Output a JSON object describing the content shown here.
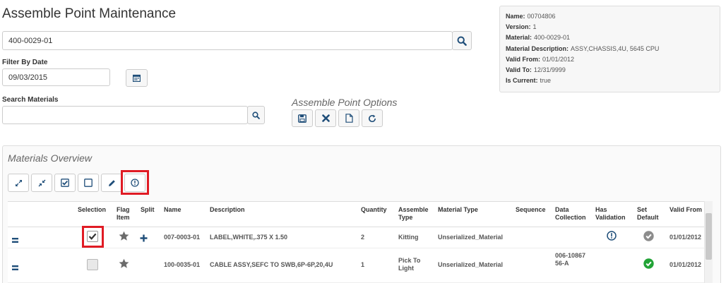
{
  "page": {
    "title": "Assemble Point Maintenance"
  },
  "search": {
    "value": "400-0029-01"
  },
  "filter": {
    "label": "Filter By Date",
    "value": "09/03/2015"
  },
  "materials_search": {
    "label": "Search Materials",
    "value": ""
  },
  "info": [
    {
      "key": "Name:",
      "value": "00704806"
    },
    {
      "key": "Version:",
      "value": "1"
    },
    {
      "key": "Material:",
      "value": "400-0029-01"
    },
    {
      "key": "Material Description:",
      "value": "ASSY,CHASSIS,4U, 5645 CPU"
    },
    {
      "key": "Valid From:",
      "value": "01/01/2012"
    },
    {
      "key": "Valid To:",
      "value": "12/31/9999"
    },
    {
      "key": "Is Current:",
      "value": "true"
    }
  ],
  "options": {
    "title": "Assemble Point Options"
  },
  "overview": {
    "title": "Materials Overview"
  },
  "columns": {
    "selection": "Selection",
    "flag": "Flag Item",
    "split": "Split",
    "name": "Name",
    "description": "Description",
    "quantity": "Quantity",
    "assemble_type": "Assemble Type",
    "material_type": "Material Type",
    "sequence": "Sequence",
    "data_collection": "Data Collection",
    "has_validation": "Has Validation",
    "set_default": "Set Default",
    "valid_from": "Valid From"
  },
  "rows": [
    {
      "name": "007-0003-01",
      "description": "LABEL,WHITE,.375 X 1.50",
      "quantity": "2",
      "assemble_type": "Kitting",
      "material_type": "Unserialized_Material",
      "sequence": "",
      "data_collection": "",
      "valid_from": "01/01/2012"
    },
    {
      "name": "100-0035-01",
      "description": "CABLE ASSY,SEFC TO SWB,6P-6P,20,4U",
      "quantity": "1",
      "assemble_type": "Pick To Light",
      "material_type": "Unserialized_Material",
      "sequence": "",
      "data_collection": "006-1086756-A",
      "valid_from": "01/01/2012"
    }
  ],
  "colors": {
    "accent": "#1f4e79",
    "highlight": "#e01b24",
    "success": "#21a336",
    "neutral": "#8c8c8c"
  }
}
